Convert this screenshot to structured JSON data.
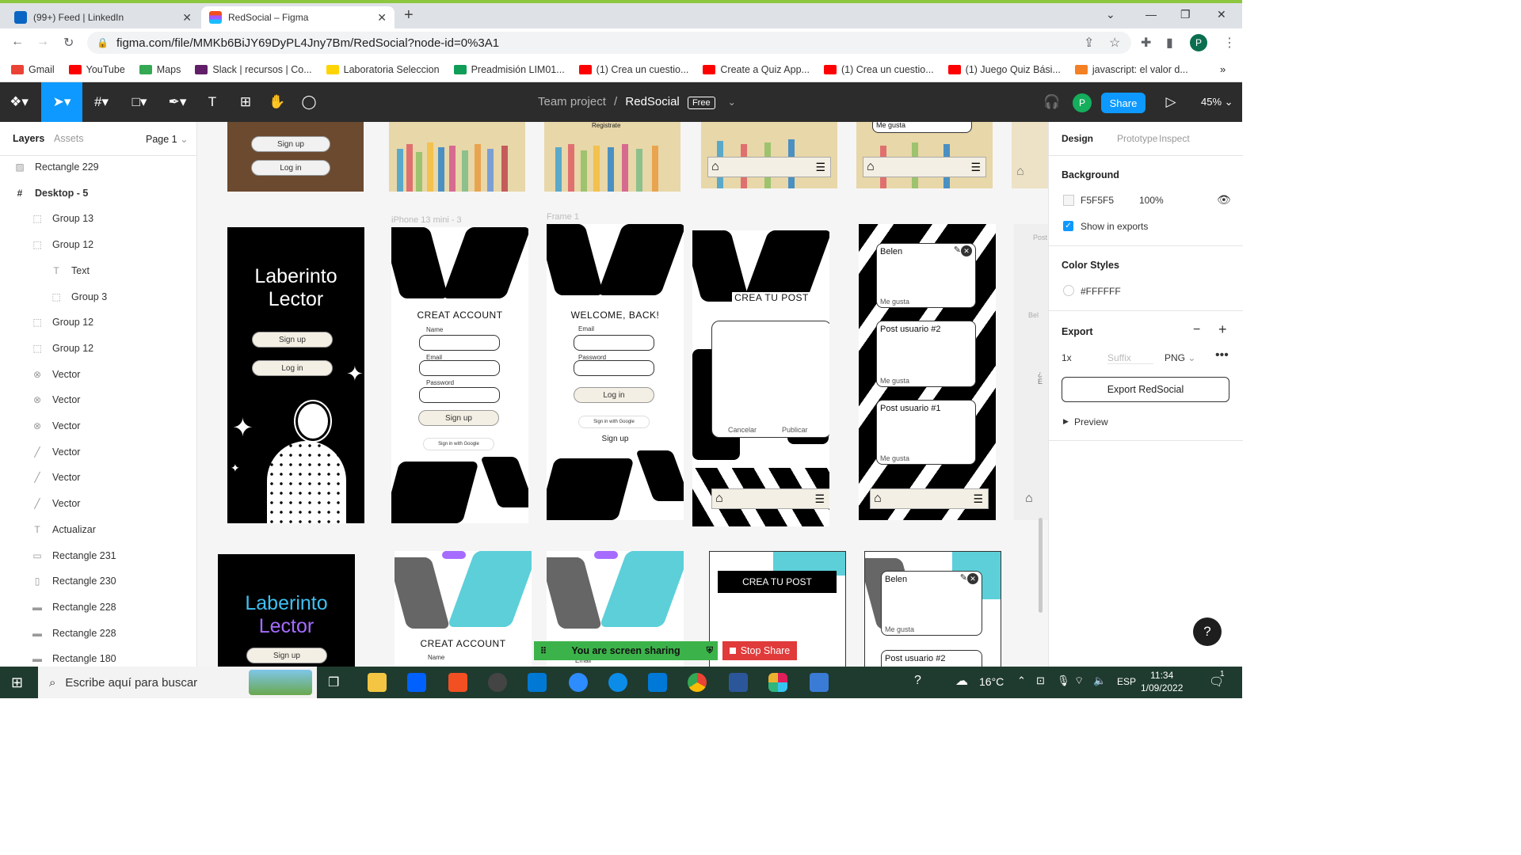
{
  "browser": {
    "tabs": [
      {
        "title": "(99+) Feed | LinkedIn",
        "color": "#0a66c2"
      },
      {
        "title": "RedSocial – Figma",
        "color": "#f24e1e"
      }
    ],
    "url": "figma.com/file/MMKb6BiJY69DyPL4Jny7Bm/RedSocial?node-id=0%3A1",
    "profile_initial": "P",
    "bookmarks": [
      {
        "label": "Gmail",
        "color": "#ea4335"
      },
      {
        "label": "YouTube",
        "color": "#ff0000"
      },
      {
        "label": "Maps",
        "color": "#34a853"
      },
      {
        "label": "Slack | recursos | Co...",
        "color": "#611f69"
      },
      {
        "label": "Laboratoria Seleccion",
        "color": "#ffd400"
      },
      {
        "label": "Preadmisión LIM01...",
        "color": "#0f9d58"
      },
      {
        "label": "(1) Crea un cuestio...",
        "color": "#ff0000"
      },
      {
        "label": "Create a Quiz App...",
        "color": "#ff0000"
      },
      {
        "label": "(1) Crea un cuestio...",
        "color": "#ff0000"
      },
      {
        "label": "(1) Juego Quiz Bási...",
        "color": "#ff0000"
      },
      {
        "label": "javascript: el valor d...",
        "color": "#f48024"
      }
    ]
  },
  "figma": {
    "team": "Team project",
    "separator": "/",
    "file": "RedSocial",
    "plan": "Free",
    "share": "Share",
    "zoom": "45%",
    "avatar": "P"
  },
  "layers_panel": {
    "tab_layers": "Layers",
    "tab_assets": "Assets",
    "page": "Page 1",
    "items": [
      {
        "label": "Rectangle 229",
        "icon": "image-icon",
        "glyph": "▨"
      },
      {
        "label": "Desktop - 5",
        "icon": "frame-icon",
        "glyph": "#"
      },
      {
        "label": "Group 13",
        "icon": "group-icon",
        "glyph": "⬚"
      },
      {
        "label": "Group 12",
        "icon": "group-icon",
        "glyph": "⬚"
      },
      {
        "label": "Text",
        "icon": "text-icon",
        "glyph": "T"
      },
      {
        "label": "Group 3",
        "icon": "group-icon",
        "glyph": "⬚"
      },
      {
        "label": "Group 12",
        "icon": "group-icon",
        "glyph": "⬚"
      },
      {
        "label": "Group 12",
        "icon": "group-icon",
        "glyph": "⬚"
      },
      {
        "label": "Vector",
        "icon": "boolean-icon",
        "glyph": "⊗"
      },
      {
        "label": "Vector",
        "icon": "boolean-icon",
        "glyph": "⊗"
      },
      {
        "label": "Vector",
        "icon": "boolean-icon",
        "glyph": "⊗"
      },
      {
        "label": "Vector",
        "icon": "vector-icon",
        "glyph": "╱"
      },
      {
        "label": "Vector",
        "icon": "vector-icon",
        "glyph": "╱"
      },
      {
        "label": "Vector",
        "icon": "vector-icon",
        "glyph": "╱"
      },
      {
        "label": "Actualizar",
        "icon": "text-icon",
        "glyph": "T"
      },
      {
        "label": "Rectangle 231",
        "icon": "rectangle-icon",
        "glyph": "▭"
      },
      {
        "label": "Rectangle 230",
        "icon": "rectangle-icon",
        "glyph": "▯"
      },
      {
        "label": "Rectangle 228",
        "icon": "rectangle-icon",
        "glyph": "▬"
      },
      {
        "label": "Rectangle 228",
        "icon": "rectangle-icon",
        "glyph": "▬"
      },
      {
        "label": "Rectangle 180",
        "icon": "rectangle-icon",
        "glyph": "▬"
      }
    ]
  },
  "canvas": {
    "frame_labels": {
      "iphone": "iPhone 13 mini - 3",
      "frame1": "Frame 1"
    },
    "top_texts": {
      "signup": "Sign up",
      "login": "Log in",
      "registrate": "Registrate",
      "megusta": "Me gusta"
    },
    "frames": {
      "brand_title_1": "Laberinto",
      "brand_title_2": "Lector",
      "sign_up": "Sign up",
      "log_in": "Log in",
      "create_account": "CREAT ACCOUNT",
      "create_account_2": "CREAT ACCOUNT",
      "name": "Name",
      "email": "Email",
      "password": "Password",
      "sign_in_google": "Sign in with Google",
      "welcome": "WELCOME, BACK!",
      "crea_post": "CREA TU POST",
      "cancelar": "Cancelar",
      "publicar": "Publicar",
      "belen": "Belen",
      "me_gusta": "Me gusta",
      "post2": "Post usuario #2",
      "post1": "Post usuario #1",
      "partial_e": "¿ E",
      "partial_bel": "Bel",
      "partial_post": "Post"
    }
  },
  "design_panel": {
    "tabs": [
      "Design",
      "Prototype",
      "Inspect"
    ],
    "background_title": "Background",
    "bg_hex": "F5F5F5",
    "bg_opacity": "100%",
    "show_in_exports": "Show in exports",
    "color_styles_title": "Color Styles",
    "color_style": "#FFFFFF",
    "export_title": "Export",
    "export_scale": "1x",
    "export_suffix": "Suffix",
    "export_format": "PNG",
    "export_button": "Export RedSocial",
    "preview": "Preview",
    "help": "?"
  },
  "screenshare": {
    "sharing": "You are screen sharing",
    "stop": "Stop Share"
  },
  "taskbar": {
    "search_placeholder": "Escribe aquí para buscar",
    "temperature": "16°C",
    "lang": "ESP",
    "time": "11:34",
    "date": "1/09/2022",
    "notifications": "1"
  }
}
